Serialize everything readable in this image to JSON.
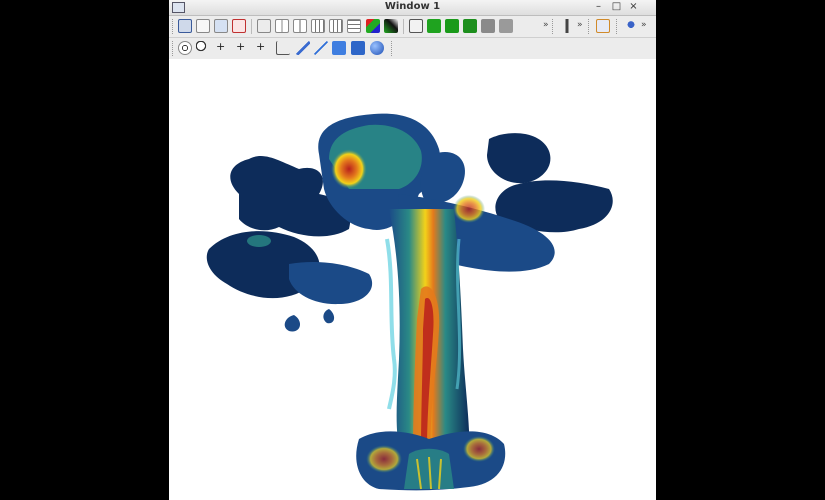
{
  "window": {
    "title": "Window 1"
  },
  "titlebar_buttons": [
    "–",
    "□",
    "×"
  ],
  "toolbar1": {
    "icons": [
      "select-view-icon",
      "new-window-icon",
      "copy-window-icon",
      "delete-window-icon",
      "layout-1x1-icon",
      "layout-2x1-icon",
      "layout-2x2-icon",
      "layout-3x2-icon",
      "layout-1x3-icon",
      "layout-3x3-icon",
      "lock-view-icon",
      "color-table-icon",
      "camera-icon",
      "camera-save-icon",
      "camera-reset-icon",
      "camera-copy-icon",
      "camera-clear-icon",
      "animation-back-icon",
      "animation-step-icon",
      "image-save-icon",
      "print-icon"
    ],
    "more_1": "»",
    "more_2": "»",
    "more_3": "»"
  },
  "toolbar2": {
    "icons": [
      "navigate-icon",
      "zoom-icon",
      "pick-zone-icon",
      "pick-node-icon",
      "pick-point-icon",
      "lineout-icon",
      "line-probe-icon",
      "line-tool-icon",
      "box-tool-icon",
      "cube-icon",
      "sphere-icon"
    ]
  },
  "colors": {
    "plume_dark": "#0d2c5a",
    "plume_mid": "#1b4a87",
    "teal": "#2a8a86",
    "yellow": "#f2d21a",
    "orange": "#e47a1c",
    "red": "#b8201c",
    "cyan": "#5fd0e0"
  }
}
